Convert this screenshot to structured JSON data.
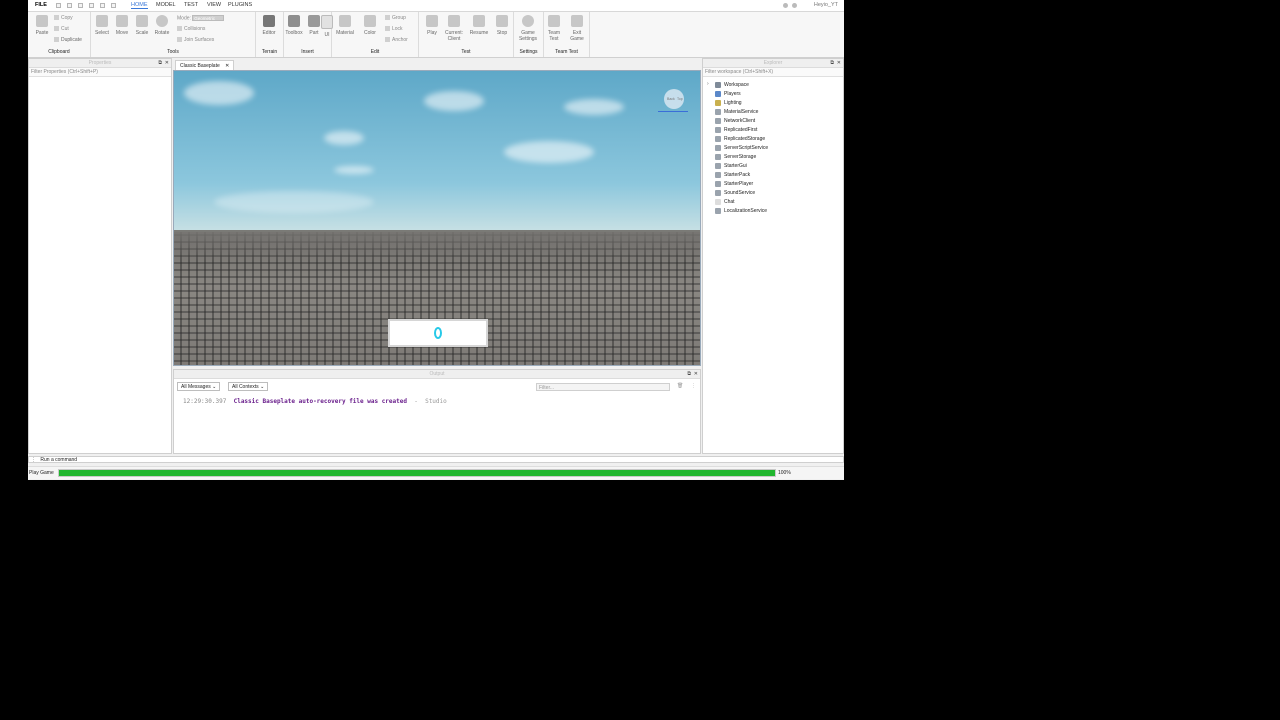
{
  "menubar": {
    "items": [
      "FILE",
      "HOME",
      "MODEL",
      "TEST",
      "VIEW",
      "PLUGINS"
    ],
    "active": "HOME",
    "user": "Heyio_YT"
  },
  "ribbon": {
    "clipboard": {
      "paste": "Paste",
      "copy": "Copy",
      "cut": "Cut",
      "duplicate": "Duplicate",
      "label": "Clipboard"
    },
    "tools": {
      "select": "Select",
      "move": "Move",
      "scale": "Scale",
      "rotate": "Rotate",
      "mode_label": "Mode:",
      "mode_value": "Geometric",
      "collisions": "Collisions",
      "join_surfaces": "Join Surfaces",
      "label": "Tools"
    },
    "terrain": {
      "editor": "Editor",
      "label": "Terrain"
    },
    "insert": {
      "toolbox": "Toolbox",
      "part": "Part",
      "ui": "UI",
      "label": "Insert"
    },
    "edit": {
      "material": "Material",
      "color": "Color",
      "group": "Group",
      "lock": "Lock",
      "anchor": "Anchor",
      "label": "Edit"
    },
    "test": {
      "play": "Play",
      "current_client": "Current: Client",
      "resume": "Resume",
      "stop": "Stop",
      "label": "Test"
    },
    "settings": {
      "game_settings": "Game Settings",
      "label": "Settings"
    },
    "team_test": {
      "team_test": "Team Test",
      "exit_game": "Exit Game",
      "label": "Team Test"
    }
  },
  "properties": {
    "title": "Properties",
    "filter_placeholder": "Filter Properties (Ctrl+Shift+P)"
  },
  "document": {
    "tab_label": "Classic Baseplate"
  },
  "explorer": {
    "title": "Explorer",
    "filter_placeholder": "Filter workspace (Ctrl+Shift+X)",
    "items": [
      "Workspace",
      "Players",
      "Lighting",
      "MaterialService",
      "NetworkClient",
      "ReplicatedFirst",
      "ReplicatedStorage",
      "ServerScriptService",
      "ServerStorage",
      "StarterGui",
      "StarterPack",
      "StarterPlayer",
      "SoundService",
      "Chat",
      "LocalizationService"
    ]
  },
  "viewport": {
    "nav_cube_left": "Back",
    "nav_cube_right": "Top"
  },
  "output": {
    "title": "Output",
    "messages_filter": "All Messages",
    "contexts_filter": "All Contexts",
    "filter_placeholder": "Filter...",
    "lines": [
      {
        "time": "12:29:30.397",
        "text": "Classic Baseplate auto-recovery file was created",
        "sep": "-",
        "source": "Studio"
      }
    ]
  },
  "command_bar": {
    "placeholder": "Run a command"
  },
  "status": {
    "label": "Play Game",
    "progress_percent": 100,
    "progress_text": "100%"
  },
  "colors": {
    "accent": "#3a78d8",
    "progress": "#20b62e",
    "message": "#6a1f8c"
  }
}
